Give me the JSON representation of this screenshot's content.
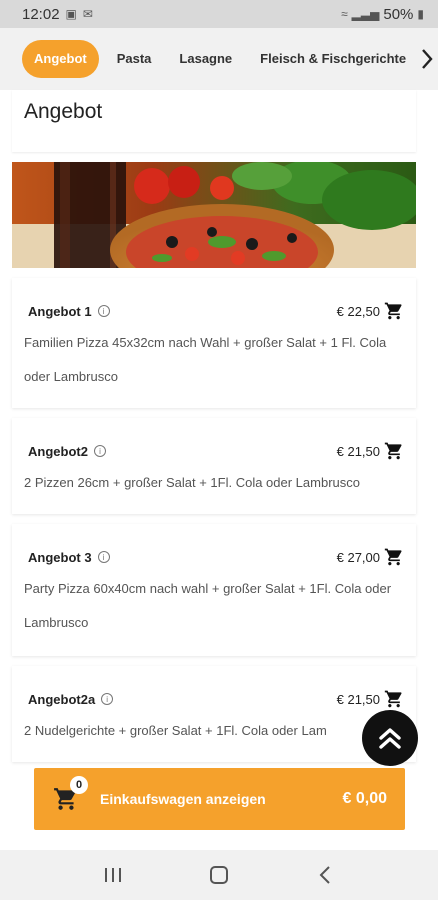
{
  "status": {
    "time": "12:02",
    "battery": "50%"
  },
  "tabs": [
    {
      "label": "Angebot",
      "active": true
    },
    {
      "label": "Pasta",
      "active": false
    },
    {
      "label": "Lasagne",
      "active": false
    },
    {
      "label": "Fleisch & Fischgerichte",
      "active": false
    }
  ],
  "section": {
    "title": "Angebot"
  },
  "offers": [
    {
      "name": "Angebot 1",
      "price": "€ 22,50",
      "description": "Familien Pizza 45x32cm nach Wahl + großer Salat + 1 Fl. Cola oder Lambrusco"
    },
    {
      "name": "Angebot2",
      "price": "€ 21,50",
      "description": "2 Pizzen 26cm + großer Salat + 1Fl. Cola oder Lambrusco"
    },
    {
      "name": "Angebot 3",
      "price": "€ 27,00",
      "description": "Party Pizza 60x40cm nach wahl + großer Salat + 1Fl. Cola oder Lambrusco"
    },
    {
      "name": "Angebot2a",
      "price": "€ 21,50",
      "description": "2 Nudelgerichte + großer Salat + 1Fl. Cola oder Lam"
    }
  ],
  "cart": {
    "count": "0",
    "label": "Einkaufswagen anzeigen",
    "total": "€ 0,00"
  },
  "colors": {
    "accent": "#f5a12c"
  }
}
